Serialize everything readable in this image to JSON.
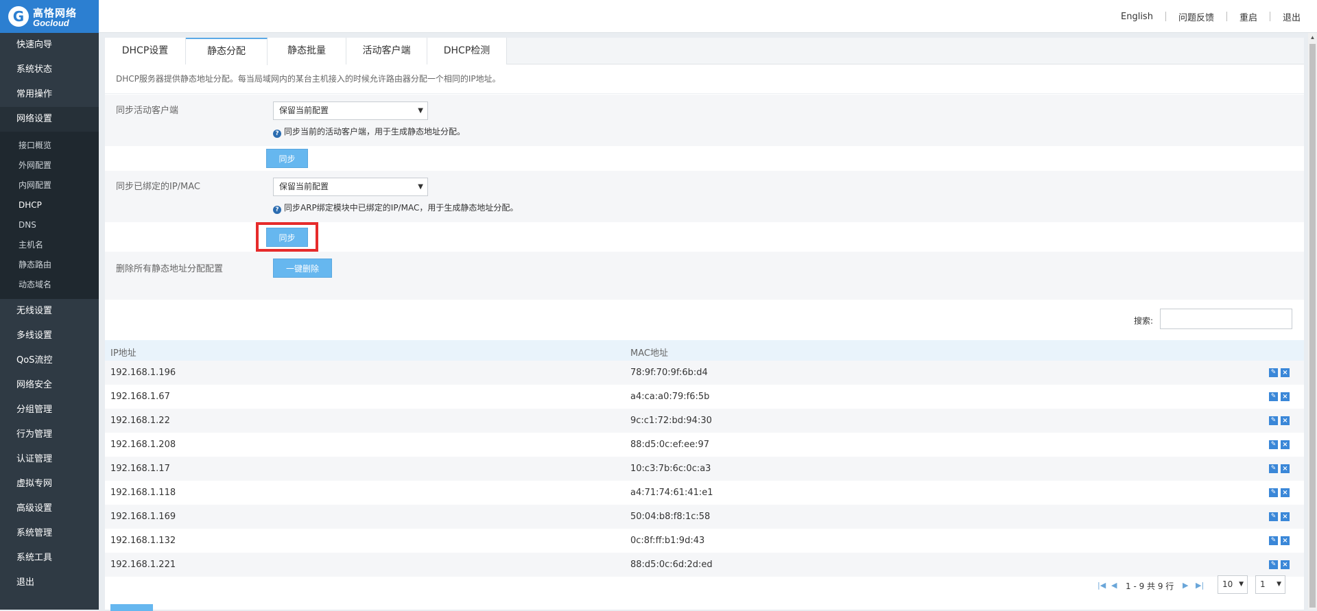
{
  "brand": {
    "cn": "高恪网络",
    "en": "Gocloud",
    "mark": "G"
  },
  "header_links": [
    "English",
    "问题反馈",
    "重启",
    "退出"
  ],
  "sidebar": {
    "top_items": [
      "快速向导",
      "系统状态",
      "常用操作",
      "网络设置"
    ],
    "sub_items": [
      "接口概览",
      "外网配置",
      "内网配置",
      "DHCP",
      "DNS",
      "主机名",
      "静态路由",
      "动态域名"
    ],
    "bottom_items": [
      "无线设置",
      "多线设置",
      "QoS流控",
      "网络安全",
      "分组管理",
      "行为管理",
      "认证管理",
      "虚拟专网",
      "高级设置",
      "系统管理",
      "系统工具",
      "退出"
    ]
  },
  "tabs": [
    "DHCP设置",
    "静态分配",
    "静态批量",
    "活动客户端",
    "DHCP检测"
  ],
  "active_tab": "静态分配",
  "description": "DHCP服务器提供静态地址分配。每当局域网内的某台主机接入的时候允许路由器分配一个相同的IP地址。",
  "sync_active": {
    "label": "同步活动客户端",
    "select_value": "保留当前配置",
    "hint": "同步当前的活动客户端，用于生成静态地址分配。",
    "button": "同步"
  },
  "sync_bound": {
    "label": "同步已绑定的IP/MAC",
    "select_value": "保留当前配置",
    "hint": "同步ARP绑定模块中已绑定的IP/MAC，用于生成静态地址分配。",
    "button": "同步"
  },
  "delete_all": {
    "label": "删除所有静态地址分配配置",
    "button": "一键删除"
  },
  "search": {
    "label": "搜索:",
    "value": ""
  },
  "table": {
    "columns": [
      "IP地址",
      "MAC地址"
    ],
    "rows": [
      [
        "192.168.1.196",
        "78:9f:70:9f:6b:d4"
      ],
      [
        "192.168.1.67",
        "a4:ca:a0:79:f6:5b"
      ],
      [
        "192.168.1.22",
        "9c:c1:72:bd:94:30"
      ],
      [
        "192.168.1.208",
        "88:d5:0c:ef:ee:97"
      ],
      [
        "192.168.1.17",
        "10:c3:7b:6c:0c:a3"
      ],
      [
        "192.168.1.118",
        "a4:71:74:61:41:e1"
      ],
      [
        "192.168.1.169",
        "50:04:b8:f8:1c:58"
      ],
      [
        "192.168.1.132",
        "0c:8f:ff:b1:9d:43"
      ],
      [
        "192.168.1.221",
        "88:d5:0c:6d:2d:ed"
      ]
    ],
    "row_actions": [
      "edit-icon",
      "delete-icon"
    ]
  },
  "pager": {
    "summary": "1 - 9 共 9 行",
    "page_size": "10",
    "page": "1"
  },
  "colors": {
    "accent": "#66b7ef",
    "brand": "#2c7fd1",
    "sidebar": "#2f3a44",
    "highlight": "#e62b2b"
  }
}
